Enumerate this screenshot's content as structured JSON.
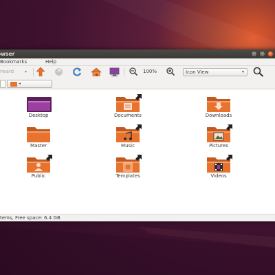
{
  "window": {
    "title": "owser",
    "accent": "#e8732f",
    "close_color": "#e3541c"
  },
  "menubar": {
    "items": [
      "Bookmarks",
      "Help"
    ]
  },
  "toolbar": {
    "back_label": "rward",
    "zoom_level": "100%",
    "view_mode": "Icon View",
    "icons": [
      "go-up-icon",
      "stop-icon",
      "reload-icon",
      "home-icon",
      "computer-icon",
      "zoom-out-icon",
      "zoom-in-icon",
      "search-icon"
    ]
  },
  "content": {
    "items": [
      {
        "label": "Desktop",
        "icon": "desktop-folder-icon"
      },
      {
        "label": "Documents",
        "icon": "documents-folder-icon"
      },
      {
        "label": "Downloads",
        "icon": "downloads-folder-icon"
      },
      {
        "label": "Master",
        "icon": "folder-icon"
      },
      {
        "label": "Music",
        "icon": "music-folder-icon"
      },
      {
        "label": "Pictures",
        "icon": "pictures-folder-icon"
      },
      {
        "label": "Public",
        "icon": "public-folder-icon"
      },
      {
        "label": "Templates",
        "icon": "templates-folder-icon"
      },
      {
        "label": "Videos",
        "icon": "videos-folder-icon"
      }
    ]
  },
  "statusbar": {
    "text": "tems, Free space: 6.4 GB"
  }
}
